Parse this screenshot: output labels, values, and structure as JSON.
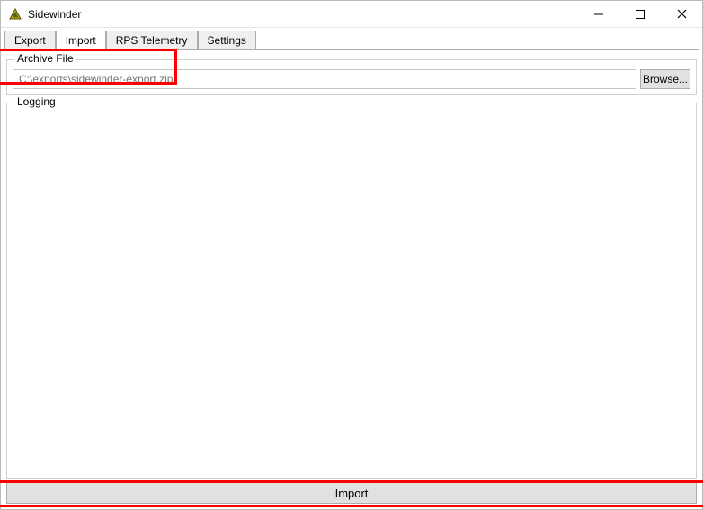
{
  "window": {
    "title": "Sidewinder"
  },
  "tabs": {
    "items": [
      {
        "label": "Export"
      },
      {
        "label": "Import"
      },
      {
        "label": "RPS Telemetry"
      },
      {
        "label": "Settings"
      }
    ],
    "active_index": 1
  },
  "archive": {
    "legend": "Archive File",
    "path_placeholder": "C:\\exports\\sidewinder-export.zip",
    "path_value": "",
    "browse_label": "Browse..."
  },
  "logging": {
    "legend": "Logging",
    "content": ""
  },
  "actions": {
    "import_label": "Import"
  },
  "highlights": {
    "archive_input": true,
    "import_button": true
  }
}
